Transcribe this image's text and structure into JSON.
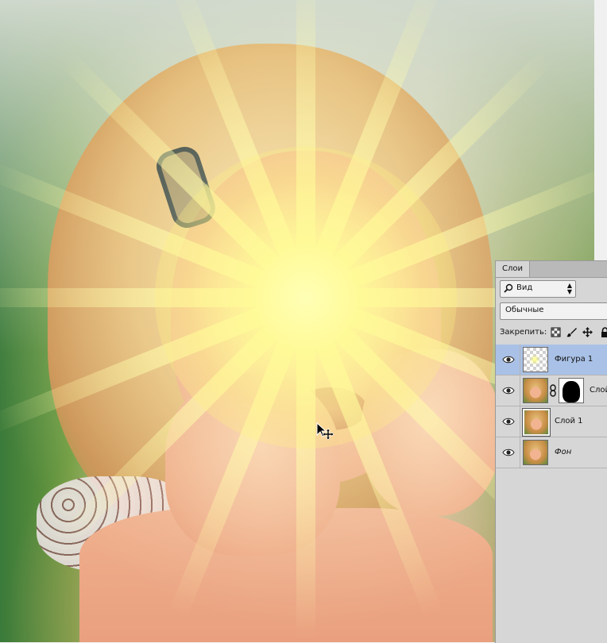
{
  "panel": {
    "tab_label": "Слои",
    "filter_label": "Вид",
    "blend_mode": "Обычные",
    "lock_label": "Закрепить:",
    "layers": [
      {
        "name": "Фигура 1",
        "visible": true,
        "selected": true,
        "thumb": "transparent-checker",
        "italic": false
      },
      {
        "name": "Слой",
        "visible": true,
        "selected": false,
        "thumb": "photo",
        "has_mask": true,
        "italic": false
      },
      {
        "name": "Слой 1",
        "visible": true,
        "selected": false,
        "thumb": "photo",
        "italic": false
      },
      {
        "name": "Фон",
        "visible": true,
        "selected": false,
        "thumb": "photo",
        "italic": true
      }
    ]
  },
  "icons": {
    "filter": "search-icon",
    "lock_transparent": "checkerboard-icon",
    "lock_pixels": "brush-icon",
    "lock_position": "move-icon",
    "lock_all": "lock-icon",
    "visibility": "eye-icon",
    "link": "chain-icon",
    "cursor": "move-cursor-icon"
  },
  "colors": {
    "panel_bg": "#d6d6d6",
    "selected_layer": "#a9c1e6",
    "flare": "#fffca8"
  }
}
